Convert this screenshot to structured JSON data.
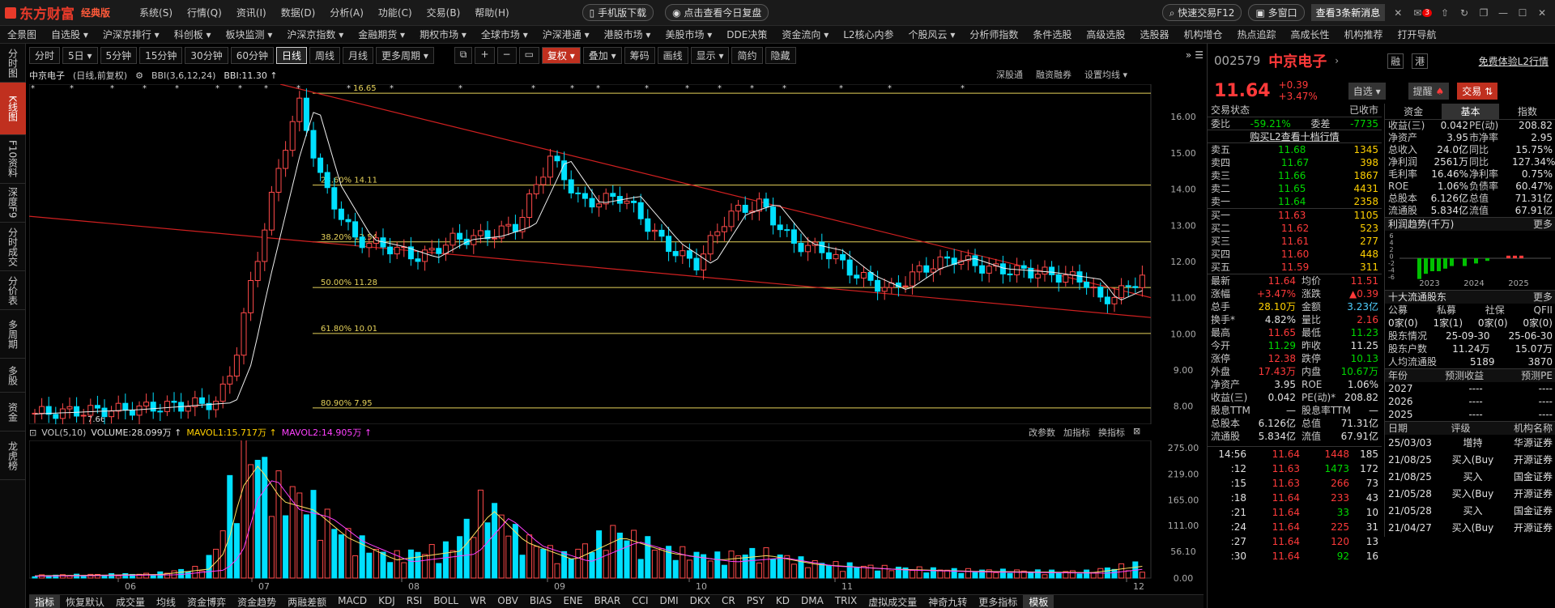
{
  "titlebar": {
    "logo": "东方财富",
    "edition": "经典版",
    "menu": [
      "系统(S)",
      "行情(Q)",
      "资讯(I)",
      "数据(D)",
      "分析(A)",
      "功能(C)",
      "交易(B)",
      "帮助(H)"
    ],
    "mobile": "手机版下载",
    "review": "点击查看今日复盘",
    "trade_hotkey": "快速交易F12",
    "multi": "多窗口",
    "msg": "查看3条新消息",
    "badge": "3"
  },
  "menubar": [
    "全景图",
    "自选股 ▾",
    "沪深京排行 ▾",
    "科创板 ▾",
    "板块监测 ▾",
    "沪深京指数 ▾",
    "金融期货 ▾",
    "期权市场 ▾",
    "全球市场 ▾",
    "沪深港通 ▾",
    "港股市场 ▾",
    "美股市场 ▾",
    "DDE决策",
    "资金流向 ▾",
    "L2核心内参",
    "个股风云 ▾",
    "分析师指数",
    "条件选股",
    "高级选股",
    "选股器",
    "机构增仓",
    "热点追踪",
    "高成长性",
    "机构推荐",
    "打开导航"
  ],
  "lefttabs": [
    "分时图",
    "K线图",
    "F10资料",
    "深度F9",
    "分时成交",
    "分价表",
    "多周期",
    "多股",
    "资金",
    "龙虎榜"
  ],
  "periods": [
    "分时",
    "5日 ▾",
    "5分钟",
    "15分钟",
    "30分钟",
    "60分钟",
    "日线",
    "周线",
    "月线",
    "更多周期 ▾"
  ],
  "tools": [
    "复权 ▾",
    "叠加 ▾",
    "筹码",
    "画线",
    "显示 ▾",
    "简约",
    "隐藏"
  ],
  "price_info": {
    "name": "中京电子",
    "mode": "(日线,前复权)",
    "bbi": "BBI(3,6,12,24)",
    "bbi_val": "BBI:11.30 ↑",
    "r1": "深股通",
    "r2": "融资融券",
    "r3": "设置均线 ▾"
  },
  "vol_info": {
    "label": "VOL(5,10)",
    "v": "VOLUME:28.099万 ↑",
    "m1": "MAVOL1:15.717万 ↑",
    "m2": "MAVOL2:14.905万 ↑",
    "r1": "改参数",
    "r2": "加指标",
    "r3": "换指标"
  },
  "chart_data": {
    "type": "candlestick",
    "price_axis": [
      "16.00",
      "15.00",
      "14.00",
      "13.00",
      "12.00",
      "11.00",
      "10.00",
      "9.00",
      "8.00"
    ],
    "vol_axis": [
      "275.00",
      "219.00",
      "165.00",
      "111.00",
      "56.10",
      "0.00"
    ],
    "months": [
      "06",
      "07",
      "08",
      "09",
      "10",
      "11",
      "12"
    ],
    "fib": [
      {
        "label": "23.60% 14.11",
        "v": 14.11
      },
      {
        "label": "38.20% 12.54",
        "v": 12.54
      },
      {
        "label": "50.00% 11.28",
        "v": 11.28
      },
      {
        "label": "61.80% 10.01",
        "v": 10.01
      },
      {
        "label": "80.90% 7.95",
        "v": 7.95
      }
    ],
    "high_label": "16.65",
    "low_label": "7.66"
  },
  "bottom_tabs": [
    "指标",
    "恢复默认",
    "成交量",
    "均线",
    "资金博弈",
    "资金趋势",
    "两融差额",
    "MACD",
    "KDJ",
    "RSI",
    "BOLL",
    "WR",
    "OBV",
    "BIAS",
    "ENE",
    "BRAR",
    "CCI",
    "DMI",
    "DKX",
    "CR",
    "PSY",
    "KD",
    "DMA",
    "TRIX",
    "虚拟成交量",
    "神奇九转",
    "更多指标",
    "模板"
  ],
  "stock": {
    "code": "002579",
    "name": "中京电子",
    "r1": "融",
    "r2": "港",
    "free": "免费体验L2行情",
    "price": "11.64",
    "chg": "+0.39",
    "pct": "+3.47%",
    "watch": "自选 ▾",
    "alert": "提醒",
    "trade": "交易"
  },
  "book": {
    "status_l": "交易状态",
    "status_r": "已收市",
    "wb": "委比",
    "wb_v": "-59.21%",
    "wc": "委差",
    "wc_v": "-7735",
    "l2": "购买L2查看十档行情",
    "asks": [
      [
        "卖五",
        "11.68",
        "1345"
      ],
      [
        "卖四",
        "11.67",
        "398"
      ],
      [
        "卖三",
        "11.66",
        "1867"
      ],
      [
        "卖二",
        "11.65",
        "4431"
      ],
      [
        "卖一",
        "11.64",
        "2358"
      ]
    ],
    "bids": [
      [
        "买一",
        "11.63",
        "1105"
      ],
      [
        "买二",
        "11.62",
        "523"
      ],
      [
        "买三",
        "11.61",
        "277"
      ],
      [
        "买四",
        "11.60",
        "448"
      ],
      [
        "买五",
        "11.59",
        "311"
      ]
    ]
  },
  "quote": [
    [
      "最新",
      "11.64",
      "均价",
      "11.51"
    ],
    [
      "涨幅",
      "+3.47%",
      "涨跌",
      "▲0.39"
    ],
    [
      "总手",
      "28.10万",
      "金额",
      "3.23亿"
    ],
    [
      "换手*",
      "4.82%",
      "量比",
      "2.16"
    ],
    [
      "最高",
      "11.65",
      "最低",
      "11.23"
    ],
    [
      "今开",
      "11.29",
      "昨收",
      "11.25"
    ],
    [
      "涨停",
      "12.38",
      "跌停",
      "10.13"
    ],
    [
      "外盘",
      "17.43万",
      "内盘",
      "10.67万"
    ],
    [
      "净资产",
      "3.95",
      "ROE",
      "1.06%"
    ],
    [
      "收益(三)",
      "0.042",
      "PE(动)*",
      "208.82"
    ],
    [
      "股息TTM",
      "—",
      "股息率TTM",
      "—"
    ],
    [
      "总股本",
      "6.126亿",
      "总值",
      "71.31亿"
    ],
    [
      "流通股",
      "5.834亿",
      "流值",
      "67.91亿"
    ]
  ],
  "ticks": [
    [
      "14:56",
      "11.64",
      "1448",
      "185"
    ],
    [
      ":12",
      "11.63",
      "1473",
      "172"
    ],
    [
      ":15",
      "11.63",
      "266",
      "73"
    ],
    [
      ":18",
      "11.64",
      "233",
      "43"
    ],
    [
      ":21",
      "11.64",
      "33",
      "10"
    ],
    [
      ":24",
      "11.64",
      "225",
      "31"
    ],
    [
      ":27",
      "11.64",
      "120",
      "13"
    ],
    [
      ":30",
      "11.64",
      "92",
      "16"
    ]
  ],
  "fin_tabs": [
    "资金",
    "基本",
    "指数"
  ],
  "fin": [
    [
      "收益(三)",
      "0.042",
      "PE(动)",
      "208.82"
    ],
    [
      "净资产",
      "3.95",
      "市净率",
      "2.95"
    ],
    [
      "总收入",
      "24.0亿",
      "同比",
      "15.75%"
    ],
    [
      "净利润",
      "2561万",
      "同比",
      "127.34%"
    ],
    [
      "毛利率",
      "16.46%",
      "净利率",
      "0.75%"
    ],
    [
      "ROE",
      "1.06%",
      "负债率",
      "60.47%"
    ],
    [
      "总股本",
      "6.126亿",
      "总值",
      "71.31亿"
    ],
    [
      "流通股",
      "5.834亿",
      "流值",
      "67.91亿"
    ]
  ],
  "profit": {
    "title": "利润趋势(千万)",
    "more": "更多",
    "axis": [
      "6",
      "4",
      "2",
      "0",
      "-2",
      "-4",
      "-6"
    ],
    "years": [
      "2023",
      "2024",
      "2025"
    ]
  },
  "holders": {
    "title": "十大流通股东",
    "more": "更多",
    "cats": [
      "公募",
      "私募",
      "社保",
      "QFII"
    ],
    "vals": [
      "0家(0)",
      "1家(1)",
      "0家(0)",
      "0家(0)"
    ],
    "rows": [
      [
        "股东情况",
        "25-09-30",
        "25-06-30"
      ],
      [
        "股东户数",
        "11.24万",
        "15.07万"
      ],
      [
        "人均流通股",
        "5189",
        "3870"
      ]
    ]
  },
  "forecast": {
    "h": [
      "年份",
      "预测收益",
      "预测PE"
    ],
    "rows": [
      [
        "2027",
        "----",
        "----"
      ],
      [
        "2026",
        "----",
        "----"
      ],
      [
        "2025",
        "----",
        "----"
      ]
    ]
  },
  "ratings": {
    "h": [
      "日期",
      "评级",
      "机构名称"
    ],
    "rows": [
      [
        "25/03/03",
        "增持",
        "华源证券"
      ],
      [
        "21/08/25",
        "买入(Buy",
        "开源证券"
      ],
      [
        "21/08/25",
        "买入",
        "国金证券"
      ],
      [
        "21/05/28",
        "买入(Buy",
        "开源证券"
      ],
      [
        "21/05/28",
        "买入",
        "国金证券"
      ],
      [
        "21/04/27",
        "买入(Buy",
        "开源证券"
      ]
    ]
  }
}
